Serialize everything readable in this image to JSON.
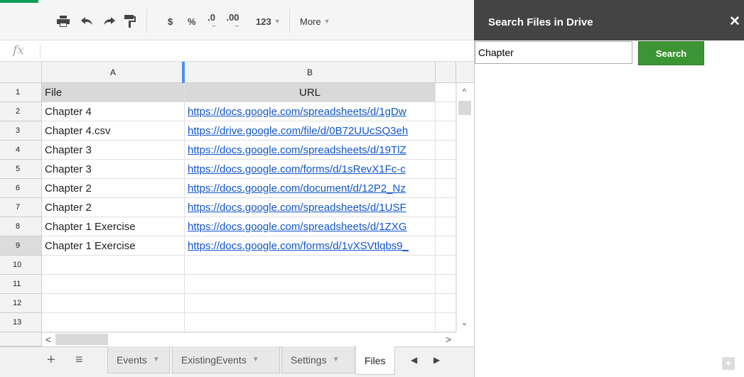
{
  "toolbar": {
    "currency": "$",
    "percent": "%",
    "decrease_decimal": ".0",
    "increase_decimal": ".00",
    "more_formats": "123",
    "more_label": "More"
  },
  "formula_bar": {
    "fx": "fx",
    "value": ""
  },
  "columns": [
    "A",
    "B"
  ],
  "rows": [
    {
      "num": "1",
      "file": "File",
      "url": "URL"
    },
    {
      "num": "2",
      "file": "Chapter 4",
      "url": "https://docs.google.com/spreadsheets/d/1gDw"
    },
    {
      "num": "3",
      "file": "Chapter 4.csv",
      "url": "https://drive.google.com/file/d/0B72UUcSQ3eh"
    },
    {
      "num": "4",
      "file": "Chapter 3",
      "url": "https://docs.google.com/spreadsheets/d/19TlZ"
    },
    {
      "num": "5",
      "file": "Chapter 3",
      "url": "https://docs.google.com/forms/d/1sRevX1Fc-c"
    },
    {
      "num": "6",
      "file": "Chapter 2",
      "url": "https://docs.google.com/document/d/12P2_Nz"
    },
    {
      "num": "7",
      "file": "Chapter 2",
      "url": "https://docs.google.com/spreadsheets/d/1USF"
    },
    {
      "num": "8",
      "file": "Chapter 1 Exercise",
      "url": "https://docs.google.com/spreadsheets/d/1ZXG"
    },
    {
      "num": "9",
      "file": "Chapter 1 Exercise",
      "url": "https://docs.google.com/forms/d/1vXSVtlqbs9_"
    },
    {
      "num": "10",
      "file": "",
      "url": ""
    },
    {
      "num": "11",
      "file": "",
      "url": ""
    },
    {
      "num": "12",
      "file": "",
      "url": ""
    },
    {
      "num": "13",
      "file": "",
      "url": ""
    }
  ],
  "sheet_tabs": [
    "Events",
    "ExistingEvents",
    "Settings",
    "Files"
  ],
  "active_tab": "Files",
  "sidebar": {
    "title": "Search Files in Drive",
    "close": "✕",
    "search_value": "Chapter",
    "search_button": "Search"
  },
  "colors": {
    "link": "#1155cc",
    "search_button": "#3d9432",
    "sidebar_header": "#444444"
  }
}
